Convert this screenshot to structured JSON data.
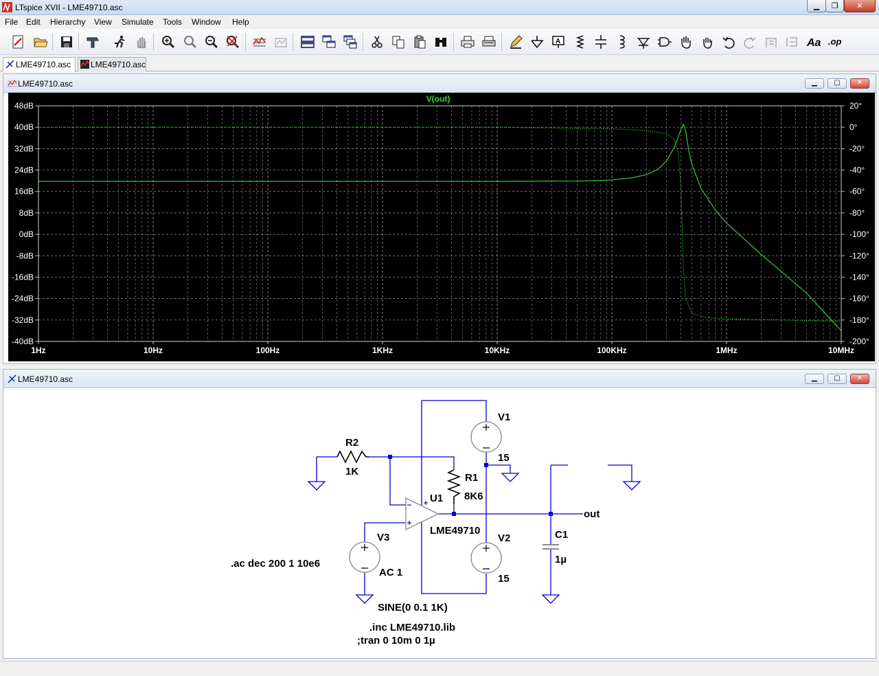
{
  "window": {
    "title": "LTspice XVII - LME49710.asc"
  },
  "menu": [
    "File",
    "Edit",
    "Hierarchy",
    "View",
    "Simulate",
    "Tools",
    "Window",
    "Help"
  ],
  "tabs": [
    {
      "label": "LME49710.asc",
      "type": "schematic"
    },
    {
      "label": "LME49710.asc",
      "type": "waveform"
    }
  ],
  "waveform_window": {
    "title": "LME49710.asc"
  },
  "schematic_window": {
    "title": "LME49710.asc"
  },
  "colors": {
    "trace": "#33dd33",
    "plot_bg": "#000000",
    "grid": "#9a9a9a",
    "wire": "#0000d8",
    "symbol": "#8a8a8a"
  },
  "chart_data": {
    "type": "line",
    "title": "V(out)",
    "x_scale": "log",
    "xlim": [
      1,
      10000000
    ],
    "x_ticks": [
      "1Hz",
      "10Hz",
      "100Hz",
      "1KHz",
      "10KHz",
      "100KHz",
      "1MHz",
      "10MHz"
    ],
    "y_left_ticks": [
      "48dB",
      "40dB",
      "32dB",
      "24dB",
      "16dB",
      "8dB",
      "0dB",
      "-8dB",
      "-16dB",
      "-24dB",
      "-32dB",
      "-40dB"
    ],
    "y_left_lim": [
      -40,
      48
    ],
    "y_right_ticks": [
      "20°",
      "0°",
      "-20°",
      "-40°",
      "-60°",
      "-80°",
      "-100°",
      "-120°",
      "-140°",
      "-160°",
      "-180°",
      "-200°"
    ],
    "y_right_lim": [
      -200,
      20
    ],
    "grid": true,
    "series": [
      {
        "quantity": "magnitude",
        "unit": "dB",
        "style": "solid",
        "points": [
          [
            1,
            19.8
          ],
          [
            10,
            19.8
          ],
          [
            100,
            19.8
          ],
          [
            1000,
            19.8
          ],
          [
            10000,
            19.8
          ],
          [
            50000,
            19.9
          ],
          [
            100000,
            20.3
          ],
          [
            150000,
            21.1
          ],
          [
            200000,
            22.3
          ],
          [
            250000,
            24.2
          ],
          [
            300000,
            27.4
          ],
          [
            350000,
            32.5
          ],
          [
            400000,
            39
          ],
          [
            420000,
            41.2
          ],
          [
            440000,
            38.5
          ],
          [
            470000,
            31
          ],
          [
            500000,
            26
          ],
          [
            600000,
            17
          ],
          [
            800000,
            9
          ],
          [
            1000000,
            4.2
          ],
          [
            2000000,
            -7.5
          ],
          [
            5000000,
            -22
          ],
          [
            10000000,
            -36
          ]
        ]
      },
      {
        "quantity": "phase",
        "unit": "°",
        "style": "dotted",
        "points": [
          [
            1,
            0
          ],
          [
            10,
            0
          ],
          [
            100,
            0
          ],
          [
            1000,
            0
          ],
          [
            10000,
            0
          ],
          [
            100000,
            -1.5
          ],
          [
            200000,
            -3
          ],
          [
            300000,
            -6
          ],
          [
            350000,
            -11
          ],
          [
            380000,
            -24
          ],
          [
            400000,
            -55
          ],
          [
            410000,
            -90
          ],
          [
            420000,
            -130
          ],
          [
            440000,
            -160
          ],
          [
            500000,
            -174
          ],
          [
            700000,
            -178
          ],
          [
            1000000,
            -179
          ],
          [
            3000000,
            -180
          ],
          [
            10000000,
            -181
          ]
        ]
      }
    ]
  },
  "schematic": {
    "components": [
      {
        "ref": "R2",
        "value": "1K"
      },
      {
        "ref": "R1",
        "value": "8K6"
      },
      {
        "ref": "U1",
        "value": "LME49710"
      },
      {
        "ref": "V1",
        "value": "15"
      },
      {
        "ref": "V2",
        "value": "15"
      },
      {
        "ref": "V3",
        "value": "AC 1"
      },
      {
        "ref": "C1",
        "value": "1µ"
      }
    ],
    "net_label": "out",
    "v3_source": "SINE(0 0.1 1K)",
    "directives": [
      ".ac dec 200 1 10e6",
      ".inc LME49710.lib",
      ";tran 0 10m 0 1µ"
    ]
  }
}
